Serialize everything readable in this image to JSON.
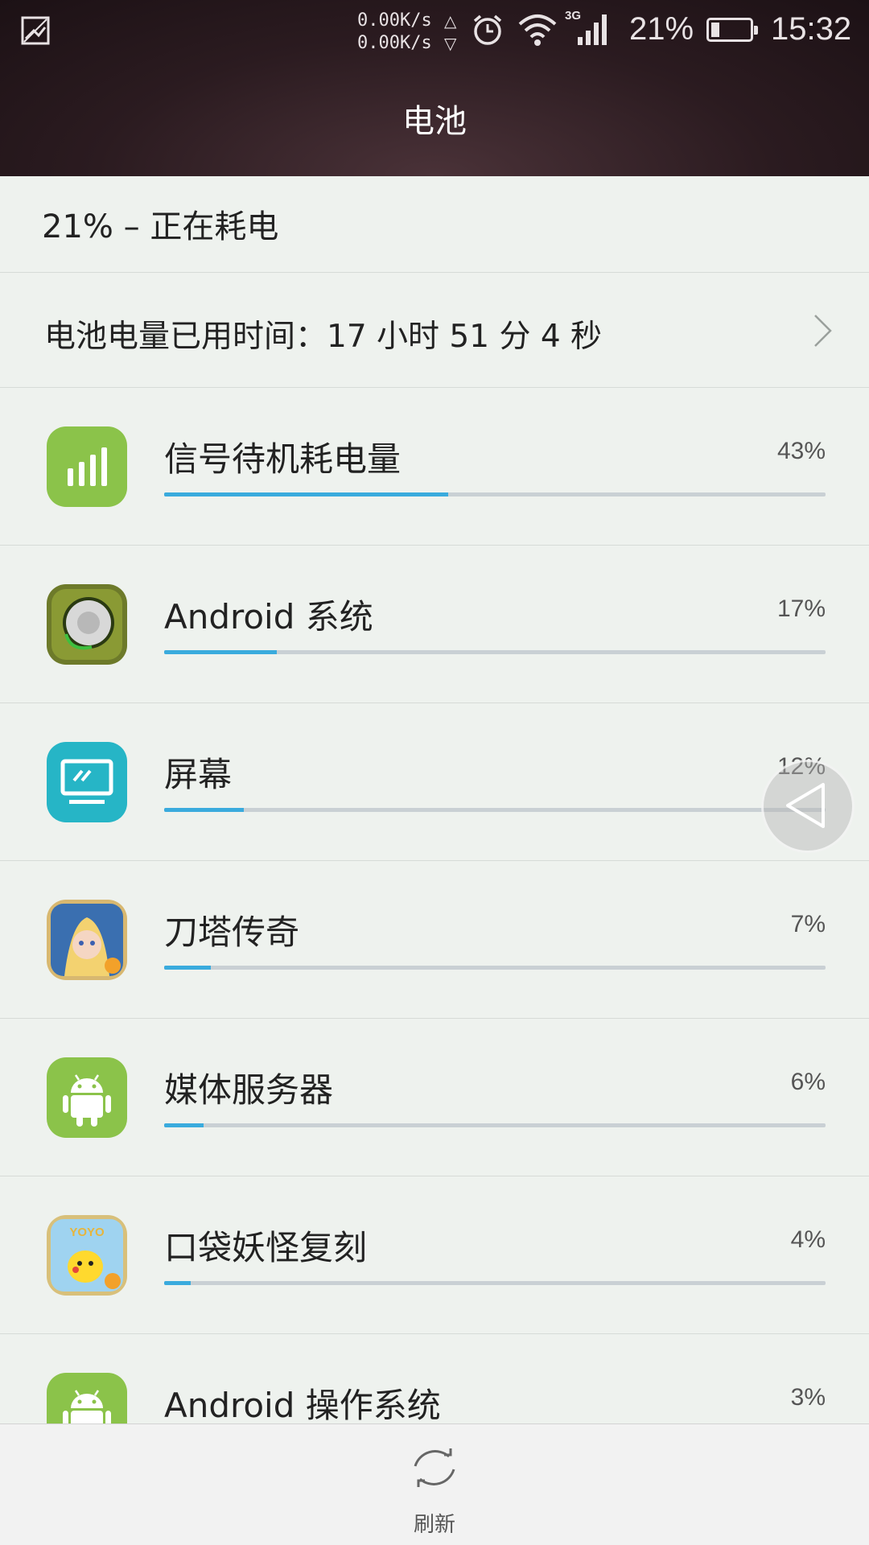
{
  "status_bar": {
    "net_up": "0.00K/s",
    "net_down": "0.00K/s",
    "network_type": "3G",
    "battery_percent": "21%",
    "battery_level": 0.21,
    "time": "15:32",
    "icons": [
      "image-icon",
      "alarm-icon",
      "wifi-icon",
      "signal-icon",
      "battery-icon"
    ]
  },
  "header": {
    "title": "电池"
  },
  "summary": {
    "status": "21% – 正在耗电",
    "usage_time": "电池电量已用时间：17 小时 51 分 4 秒"
  },
  "apps": [
    {
      "name": "信号待机耗电量",
      "percent": "43%",
      "value": 43,
      "icon": "signal-standby-icon",
      "icon_bg": "#8bc34a"
    },
    {
      "name": "Android 系统",
      "percent": "17%",
      "value": 17,
      "icon": "android-system-icon",
      "icon_bg": "#6d7a2a"
    },
    {
      "name": "屏幕",
      "percent": "12%",
      "value": 12,
      "icon": "screen-icon",
      "icon_bg": "#26b5c6"
    },
    {
      "name": "刀塔传奇",
      "percent": "7%",
      "value": 7,
      "icon": "dota-legend-icon",
      "icon_bg": "#3a6fb0"
    },
    {
      "name": "媒体服务器",
      "percent": "6%",
      "value": 6,
      "icon": "android-icon",
      "icon_bg": "#8bc34a"
    },
    {
      "name": "口袋妖怪复刻",
      "percent": "4%",
      "value": 4,
      "icon": "pokemon-icon",
      "icon_bg": "#e7b53c"
    },
    {
      "name": "Android 操作系统",
      "percent": "3%",
      "value": 3,
      "icon": "android-icon",
      "icon_bg": "#8bc34a"
    }
  ],
  "bar_scale_max": 43,
  "bottom": {
    "refresh_label": "刷新"
  },
  "colors": {
    "accent": "#3aabdd",
    "track": "#c9d0d4"
  }
}
